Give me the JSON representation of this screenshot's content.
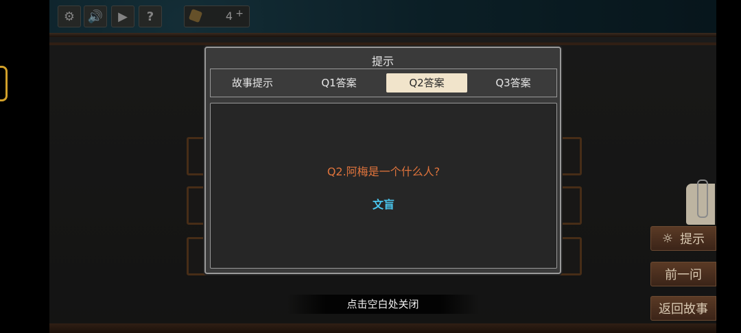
{
  "toolbar": {
    "settings_icon": "gear-icon",
    "sound_icon": "speaker-icon",
    "skip_icon": "skip-icon",
    "help_label": "?",
    "counter_value": "4",
    "counter_plus": "+"
  },
  "modal": {
    "title": "提示",
    "tabs": [
      {
        "label": "故事提示"
      },
      {
        "label": "Q1答案"
      },
      {
        "label": "Q2答案"
      },
      {
        "label": "Q3答案"
      }
    ],
    "active_tab": 2,
    "question": "Q2.阿梅是一个什么人?",
    "answer": "文盲"
  },
  "side_menu": {
    "hint_label": "提示",
    "prev_label": "前一问",
    "back_label": "返回故事"
  },
  "footer": {
    "close_hint": "点击空白处关闭"
  },
  "colors": {
    "accent_question": "#e0743c",
    "accent_answer": "#4ac6ee",
    "active_tab_bg": "#f1e4cb"
  }
}
